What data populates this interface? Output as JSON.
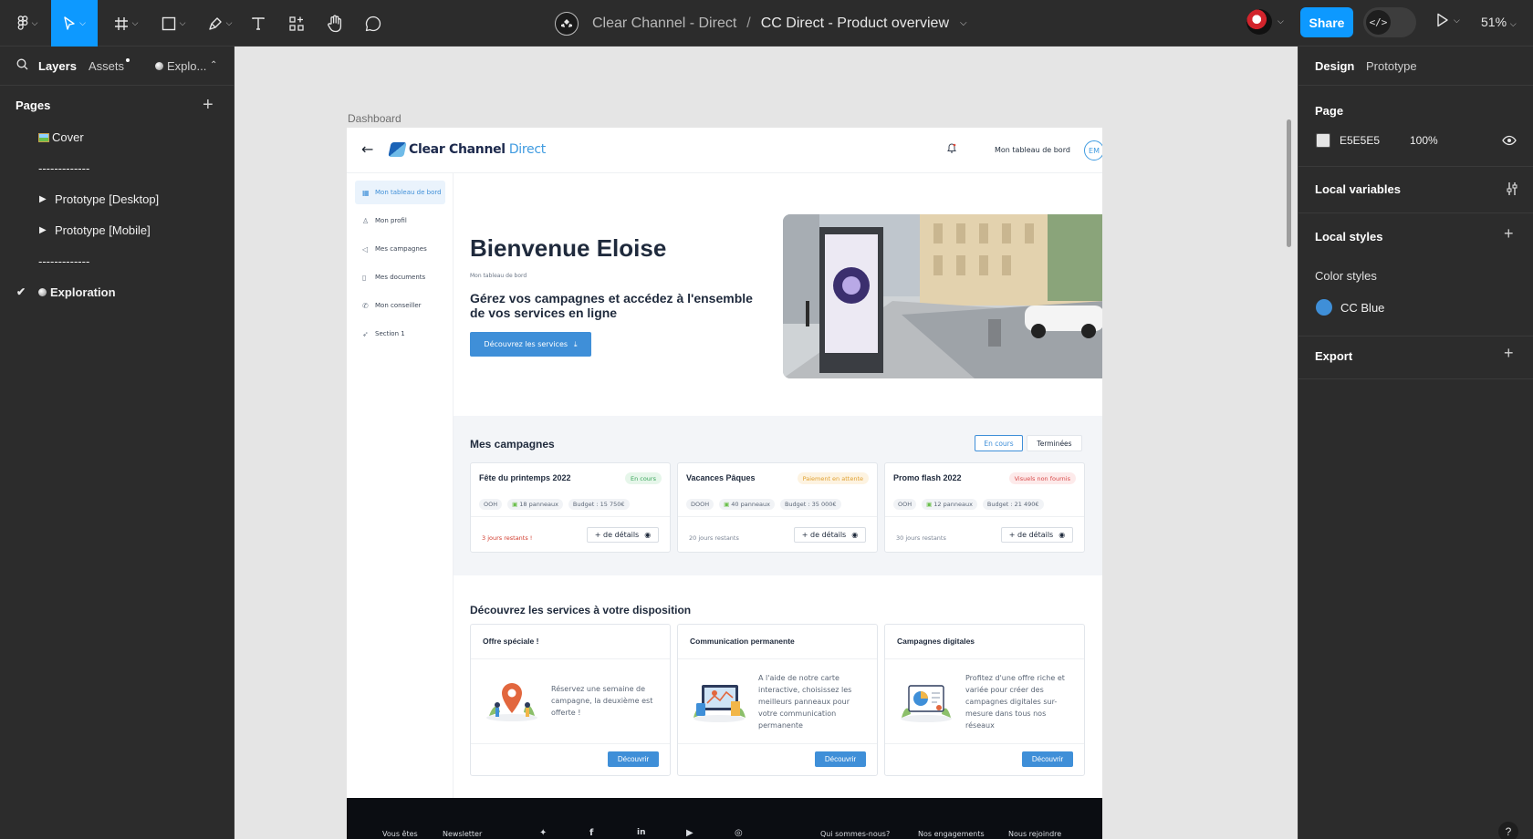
{
  "toolbar": {
    "tools": [
      "main-menu",
      "move",
      "frame",
      "shape",
      "pen",
      "text",
      "components",
      "hand",
      "comment"
    ],
    "project": "Clear Channel - Direct",
    "separator": "/",
    "file": "CC Direct - Product overview",
    "share_label": "Share",
    "zoom": "51%"
  },
  "left_panel": {
    "tabs": {
      "layers": "Layers",
      "assets": "Assets",
      "current": "Explo..."
    },
    "pages_title": "Pages",
    "pages": [
      {
        "label": "Cover",
        "icon": "image-icon"
      },
      {
        "label": "-------------"
      },
      {
        "label": "Prototype [Desktop]"
      },
      {
        "label": "Prototype [Mobile]"
      },
      {
        "label": "-------------"
      },
      {
        "label": "Exploration",
        "icon": "exploration-icon",
        "selected": true
      }
    ]
  },
  "canvas": {
    "background": "#E5E5E5",
    "frame_label": "Dashboard",
    "frame": {
      "header": {
        "logo_main": "Clear Channel",
        "logo_accent": "Direct",
        "dashboard_link": "Mon tableau de bord",
        "avatar_initials": "EM"
      },
      "nav": [
        {
          "label": "Mon tableau de bord",
          "icon": "dashboard-icon",
          "active": true
        },
        {
          "label": "Mon profil",
          "icon": "user-icon"
        },
        {
          "label": "Mes campagnes",
          "icon": "megaphone-icon"
        },
        {
          "label": "Mes documents",
          "icon": "document-icon"
        },
        {
          "label": "Mon conseiller",
          "icon": "phone-icon"
        },
        {
          "label": "Section 1",
          "icon": "rocket-icon"
        }
      ],
      "hero": {
        "title": "Bienvenue Eloise",
        "crumb": "Mon tableau de bord",
        "subtitle": "Gérez vos campagnes et accédez à l'ensemble de vos services en ligne",
        "button": "Découvrez les services"
      },
      "campaigns": {
        "title": "Mes campagnes",
        "toggle_active": "En cours",
        "toggle_inactive": "Terminées",
        "cards": [
          {
            "name": "Fête du printemps 2022",
            "status": "En cours",
            "status_bg": "#e6f6ea",
            "status_fg": "#3aa65a",
            "tags": [
              "OOH",
              "18 panneaux",
              "Budget : 15 750€"
            ],
            "remaining": "3 jours restants !",
            "urgent": true,
            "details": "+ de détails"
          },
          {
            "name": "Vacances Pâques",
            "status": "Paiement en attente",
            "status_bg": "#fdf3e1",
            "status_fg": "#e0a030",
            "tags": [
              "DOOH",
              "40 panneaux",
              "Budget : 35 000€"
            ],
            "remaining": "20 jours restants",
            "urgent": false,
            "details": "+ de détails"
          },
          {
            "name": "Promo flash 2022",
            "status": "Visuels non fournis",
            "status_bg": "#fdeaea",
            "status_fg": "#d84a4a",
            "tags": [
              "OOH",
              "12 panneaux",
              "Budget : 21 490€"
            ],
            "remaining": "30 jours restants",
            "urgent": false,
            "details": "+ de détails"
          }
        ]
      },
      "services": {
        "title": "Découvrez les services à votre disposition",
        "cards": [
          {
            "title": "Offre spéciale !",
            "text": "Réservez une semaine de campagne, la deuxième est offerte !",
            "button": "Découvrir"
          },
          {
            "title": "Communication permanente",
            "text": "A l'aide de notre carte interactive, choisissez les meilleurs panneaux pour votre communication permanente",
            "button": "Découvrir"
          },
          {
            "title": "Campagnes digitales",
            "text": "Profitez d'une offre riche et variée pour créer des campagnes digitales sur-mesure dans tous nos réseaux",
            "button": "Découvrir"
          }
        ]
      },
      "footer": {
        "links_left": [
          "Vous êtes",
          "Newsletter"
        ],
        "social": [
          "twitter-icon",
          "facebook-icon",
          "linkedin-icon",
          "youtube-icon",
          "instagram-icon"
        ],
        "links_right": [
          "Qui sommes-nous?",
          "Nos engagements",
          "Nous rejoindre"
        ]
      }
    }
  },
  "right_panel": {
    "tabs": {
      "design": "Design",
      "prototype": "Prototype"
    },
    "page_label": "Page",
    "page_color": "E5E5E5",
    "page_opacity": "100%",
    "local_variables": "Local variables",
    "local_styles": "Local styles",
    "color_styles": "Color styles",
    "color_style_name": "CC Blue",
    "color_style_hex": "#3F8FD8",
    "export": "Export"
  }
}
